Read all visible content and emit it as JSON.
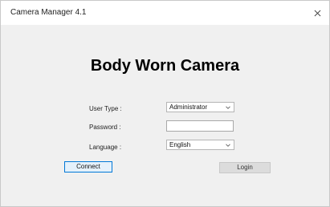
{
  "window": {
    "title": "Camera Manager 4.1"
  },
  "main": {
    "heading": "Body Worn Camera",
    "user_type": {
      "label": "User Type :",
      "selected": "Administrator"
    },
    "password": {
      "label": "Password :",
      "value": ""
    },
    "language": {
      "label": "Language :",
      "selected": "English"
    },
    "connect_label": "Connect",
    "login_label": "Login"
  },
  "icons": {
    "close": "close-icon",
    "dropdown": "chevron-down-icon"
  }
}
